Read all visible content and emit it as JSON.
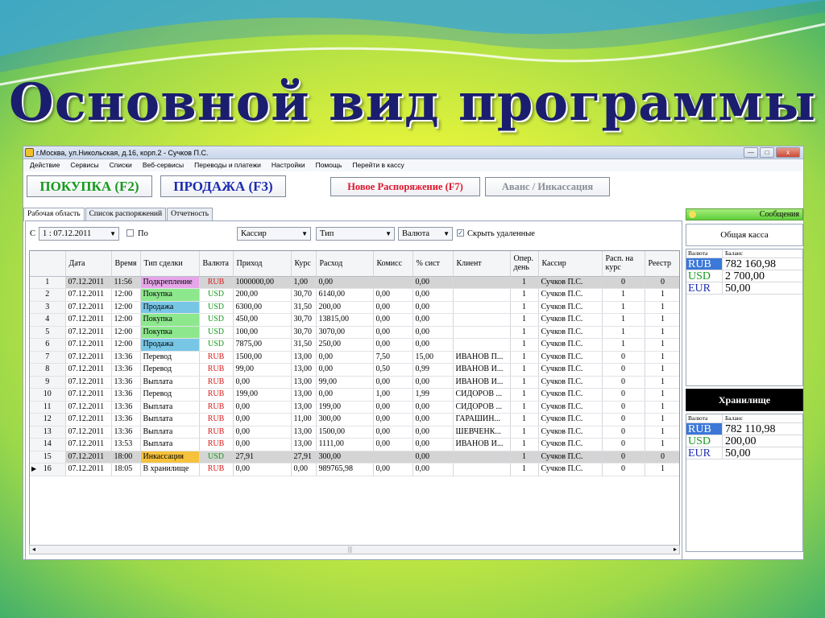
{
  "slide": {
    "title": "Основной вид программы"
  },
  "window": {
    "title": "г.Москва, ул.Никольская, д.16, корп.2 - Сучков П.С.",
    "controls": {
      "minimize": "—",
      "maximize": "□",
      "close": "x"
    }
  },
  "menu": [
    "Действие",
    "Сервисы",
    "Списки",
    "Веб-сервисы",
    "Переводы и платежи",
    "Настройки",
    "Помощь",
    "Перейти в кассу"
  ],
  "toolbar": {
    "buy": "ПОКУПКА (F2)",
    "sell": "ПРОДАЖА (F3)",
    "new_order": "Новое Распоряжение (F7)",
    "advance": "Аванс / Инкассация"
  },
  "tabs": [
    "Рабочая область",
    "Список распоряжений",
    "Отчетность"
  ],
  "filters": {
    "from_label": "С",
    "from_value": "1 : 07.12.2011",
    "to_label": "По",
    "cashier": "Кассир",
    "type": "Тип",
    "currency": "Валюта",
    "hide_deleted_label": "Скрыть удаленные",
    "hide_deleted_checked": true
  },
  "grid": {
    "columns": [
      "Дата",
      "Время",
      "Тип сделки",
      "Валюта",
      "Приход",
      "Курс",
      "Расход",
      "Комисс",
      "% сист",
      "Клиент",
      "Опер. день",
      "Кассир",
      "Расп. на курс",
      "Реестр"
    ],
    "rows": [
      {
        "n": "1",
        "date": "07.12.2011",
        "time": "11:56",
        "type": "Подкрепление",
        "type_color": "pink",
        "cur": "RUB",
        "in": "1000000,00",
        "rate": "1,00",
        "out": "0,00",
        "com": "",
        "pct": "0,00",
        "client": "",
        "day": "1",
        "cashier": "Сучков П.С.",
        "ord": "0",
        "reg": "0",
        "gray": true
      },
      {
        "n": "2",
        "date": "07.12.2011",
        "time": "12:00",
        "type": "Покупка",
        "type_color": "green",
        "cur": "USD",
        "in": "200,00",
        "rate": "30,70",
        "out": "6140,00",
        "com": "0,00",
        "pct": "0,00",
        "client": "",
        "day": "1",
        "cashier": "Сучков П.С.",
        "ord": "1",
        "reg": "1",
        "gray": false
      },
      {
        "n": "3",
        "date": "07.12.2011",
        "time": "12:00",
        "type": "Продажа",
        "type_color": "blue",
        "cur": "USD",
        "in": "6300,00",
        "rate": "31,50",
        "out": "200,00",
        "com": "0,00",
        "pct": "0,00",
        "client": "",
        "day": "1",
        "cashier": "Сучков П.С.",
        "ord": "1",
        "reg": "1",
        "gray": false
      },
      {
        "n": "4",
        "date": "07.12.2011",
        "time": "12:00",
        "type": "Покупка",
        "type_color": "green",
        "cur": "USD",
        "in": "450,00",
        "rate": "30,70",
        "out": "13815,00",
        "com": "0,00",
        "pct": "0,00",
        "client": "",
        "day": "1",
        "cashier": "Сучков П.С.",
        "ord": "1",
        "reg": "1",
        "gray": false
      },
      {
        "n": "5",
        "date": "07.12.2011",
        "time": "12:00",
        "type": "Покупка",
        "type_color": "green",
        "cur": "USD",
        "in": "100,00",
        "rate": "30,70",
        "out": "3070,00",
        "com": "0,00",
        "pct": "0,00",
        "client": "",
        "day": "1",
        "cashier": "Сучков П.С.",
        "ord": "1",
        "reg": "1",
        "gray": false
      },
      {
        "n": "6",
        "date": "07.12.2011",
        "time": "12:00",
        "type": "Продажа",
        "type_color": "blue",
        "cur": "USD",
        "in": "7875,00",
        "rate": "31,50",
        "out": "250,00",
        "com": "0,00",
        "pct": "0,00",
        "client": "",
        "day": "1",
        "cashier": "Сучков П.С.",
        "ord": "1",
        "reg": "1",
        "gray": false
      },
      {
        "n": "7",
        "date": "07.12.2011",
        "time": "13:36",
        "type": "Перевод",
        "type_color": "",
        "cur": "RUB",
        "in": "1500,00",
        "rate": "13,00",
        "out": "0,00",
        "com": "7,50",
        "pct": "15,00",
        "client": "ИВАНОВ П...",
        "day": "1",
        "cashier": "Сучков П.С.",
        "ord": "0",
        "reg": "1",
        "gray": false
      },
      {
        "n": "8",
        "date": "07.12.2011",
        "time": "13:36",
        "type": "Перевод",
        "type_color": "",
        "cur": "RUB",
        "in": "99,00",
        "rate": "13,00",
        "out": "0,00",
        "com": "0,50",
        "pct": "0,99",
        "client": "ИВАНОВ И...",
        "day": "1",
        "cashier": "Сучков П.С.",
        "ord": "0",
        "reg": "1",
        "gray": false
      },
      {
        "n": "9",
        "date": "07.12.2011",
        "time": "13:36",
        "type": "Выплата",
        "type_color": "",
        "cur": "RUB",
        "in": "0,00",
        "rate": "13,00",
        "out": "99,00",
        "com": "0,00",
        "pct": "0,00",
        "client": "ИВАНОВ И...",
        "day": "1",
        "cashier": "Сучков П.С.",
        "ord": "0",
        "reg": "1",
        "gray": false
      },
      {
        "n": "10",
        "date": "07.12.2011",
        "time": "13:36",
        "type": "Перевод",
        "type_color": "",
        "cur": "RUB",
        "in": "199,00",
        "rate": "13,00",
        "out": "0,00",
        "com": "1,00",
        "pct": "1,99",
        "client": "СИДОРОВ ...",
        "day": "1",
        "cashier": "Сучков П.С.",
        "ord": "0",
        "reg": "1",
        "gray": false
      },
      {
        "n": "11",
        "date": "07.12.2011",
        "time": "13:36",
        "type": "Выплата",
        "type_color": "",
        "cur": "RUB",
        "in": "0,00",
        "rate": "13,00",
        "out": "199,00",
        "com": "0,00",
        "pct": "0,00",
        "client": "СИДОРОВ ...",
        "day": "1",
        "cashier": "Сучков П.С.",
        "ord": "0",
        "reg": "1",
        "gray": false
      },
      {
        "n": "12",
        "date": "07.12.2011",
        "time": "13:36",
        "type": "Выплата",
        "type_color": "",
        "cur": "RUB",
        "in": "0,00",
        "rate": "11,00",
        "out": "300,00",
        "com": "0,00",
        "pct": "0,00",
        "client": "ГАРАШИН...",
        "day": "1",
        "cashier": "Сучков П.С.",
        "ord": "0",
        "reg": "1",
        "gray": false
      },
      {
        "n": "13",
        "date": "07.12.2011",
        "time": "13:36",
        "type": "Выплата",
        "type_color": "",
        "cur": "RUB",
        "in": "0,00",
        "rate": "13,00",
        "out": "1500,00",
        "com": "0,00",
        "pct": "0,00",
        "client": "ШЕВЧЕНК...",
        "day": "1",
        "cashier": "Сучков П.С.",
        "ord": "0",
        "reg": "1",
        "gray": false
      },
      {
        "n": "14",
        "date": "07.12.2011",
        "time": "13:53",
        "type": "Выплата",
        "type_color": "",
        "cur": "RUB",
        "in": "0,00",
        "rate": "13,00",
        "out": "1111,00",
        "com": "0,00",
        "pct": "0,00",
        "client": "ИВАНОВ И...",
        "day": "1",
        "cashier": "Сучков П.С.",
        "ord": "0",
        "reg": "1",
        "gray": false
      },
      {
        "n": "15",
        "date": "07.12.2011",
        "time": "18:00",
        "type": "Инкассация",
        "type_color": "orange",
        "cur": "USD",
        "in": "27,91",
        "rate": "27,91",
        "out": "300,00",
        "com": "",
        "pct": "0,00",
        "client": "",
        "day": "1",
        "cashier": "Сучков П.С.",
        "ord": "0",
        "reg": "0",
        "gray": true
      },
      {
        "n": "16",
        "date": "07.12.2011",
        "time": "18:05",
        "type": "В хранилище",
        "type_color": "",
        "cur": "RUB",
        "in": "0,00",
        "rate": "0,00",
        "out": "989765,98",
        "com": "0,00",
        "pct": "0,00",
        "client": "",
        "day": "1",
        "cashier": "Сучков П.С.",
        "ord": "0",
        "reg": "1",
        "gray": false,
        "current": true
      }
    ]
  },
  "side": {
    "messages": "Сообщения",
    "cash_title": "Общая касса",
    "vault_title": "Хранилище",
    "col_currency": "Валюта",
    "col_balance": "Баланс",
    "cash": [
      {
        "cur": "RUB",
        "bal": "782 160,98",
        "color": "#2f6bd1",
        "selected": true
      },
      {
        "cur": "USD",
        "bal": "2 700,00",
        "color": "#169a1d",
        "selected": false
      },
      {
        "cur": "EUR",
        "bal": "50,00",
        "color": "#1c2bb0",
        "selected": false
      }
    ],
    "vault": [
      {
        "cur": "RUB",
        "bal": "782 110,98",
        "color": "#2f6bd1",
        "selected": true
      },
      {
        "cur": "USD",
        "bal": "200,00",
        "color": "#169a1d",
        "selected": false
      },
      {
        "cur": "EUR",
        "bal": "50,00",
        "color": "#1c2bb0",
        "selected": false
      }
    ]
  },
  "colors": {
    "rub": "#d61c1c",
    "usd": "#169a1d"
  },
  "scrollbar": {
    "left": "◂",
    "mid": "|||",
    "right": "▸"
  }
}
